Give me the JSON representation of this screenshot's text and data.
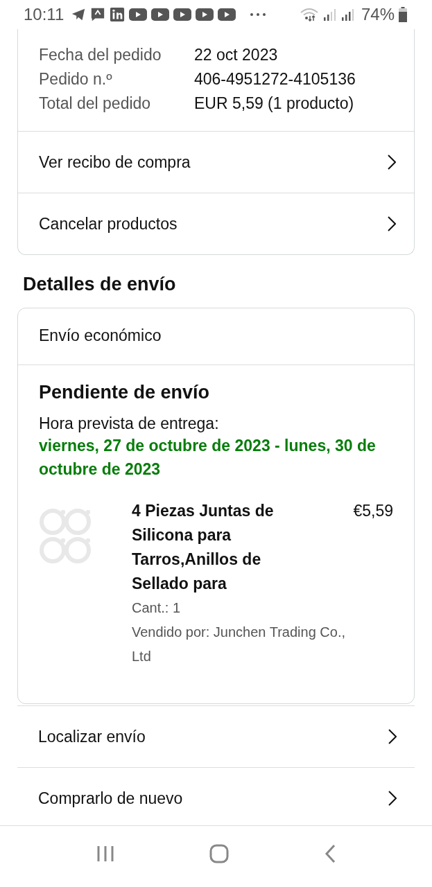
{
  "status_bar": {
    "time": "10:11",
    "battery": "74%"
  },
  "order_summary": {
    "rows": [
      {
        "label": "Fecha del pedido",
        "value": "22 oct 2023"
      },
      {
        "label": "Pedido n.º",
        "value": "406-4951272-4105136"
      },
      {
        "label": "Total del pedido",
        "value": "EUR 5,59 (1 producto)"
      }
    ],
    "links": [
      "Ver recibo de compra",
      "Cancelar productos"
    ]
  },
  "shipping": {
    "heading": "Detalles de envío",
    "method": "Envío económico",
    "status": "Pendiente de envío",
    "eta_label": "Hora prevista de entrega:",
    "eta": "viernes, 27 de octubre de 2023 - lunes, 30 de octubre de 2023",
    "item": {
      "title": "4 Piezas Juntas de Silicona para Tarros,Anillos de Sellado para",
      "price": "€5,59",
      "quantity": "Cant.: 1",
      "seller": "Vendido por: Junchen Trading Co., Ltd"
    }
  },
  "actions": [
    "Localizar envío",
    "Comprarlo de nuevo"
  ]
}
